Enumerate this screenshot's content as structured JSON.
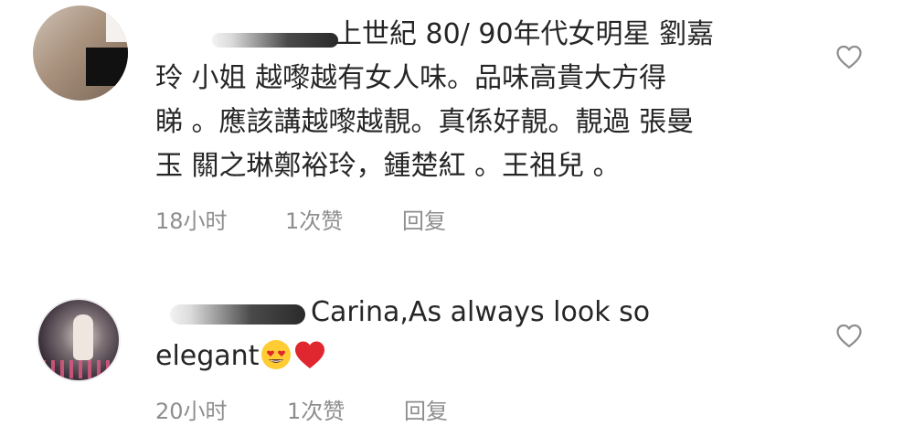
{
  "comments": [
    {
      "lines": [
        "上世紀 80/ 90年代女明星 劉嘉",
        "玲 小姐 越嚟越有女人味。品味高貴大方得",
        "睇 。應該講越嚟越靚。真係好靚。靚過 張曼",
        "玉 關之琳鄭裕玲，鍾楚紅 。王祖兒 。"
      ],
      "time": "18小时",
      "likes": "1次赞",
      "reply": "回复"
    },
    {
      "lines": [
        "Carina,As always look so",
        "elegant"
      ],
      "emojis": [
        "heart-eyes-emoji",
        "red-heart-emoji"
      ],
      "time": "20小时",
      "likes": "1次赞",
      "reply": "回复"
    }
  ],
  "icons": {
    "like": "heart-outline-icon"
  },
  "colors": {
    "text": "#262626",
    "meta": "#8e8e8e",
    "heart_emoji": "#e0262e",
    "face_emoji": "#ffcc33"
  }
}
